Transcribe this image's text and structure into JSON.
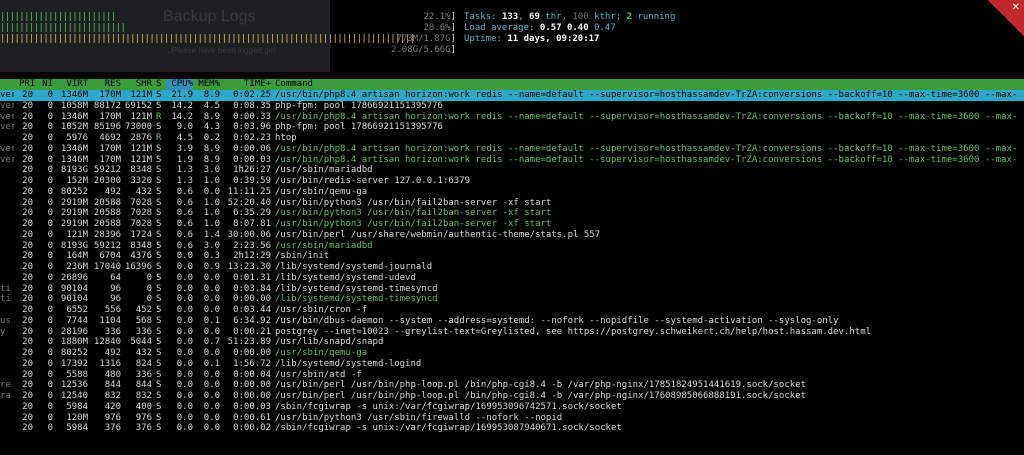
{
  "background": {
    "title": "Backup Logs",
    "subtitle": "...Please have been logged get"
  },
  "meters": [
    {
      "bars": "||||||||||||||||||||||||",
      "value": "22.1%"
    },
    {
      "bars": "||||||||||||||||||||||||||",
      "value": "28.6%"
    },
    {
      "bars": "||||||||||||||||||||||||||||||||||||||||||||||||||||||||||||||||||||||||||||||||||||||",
      "value": "773M/1.87G"
    },
    {
      "bars": "",
      "value": "2.08G/5.66G"
    }
  ],
  "stats": {
    "tasks_label": "Tasks: ",
    "tasks": "133",
    "thr": "69",
    "thr_label": " thr, ",
    "kthr": "100",
    "kthr_label": " kthr; ",
    "running": "2",
    "running_label": " running",
    "load_label": "Load average: ",
    "load1": "0.57",
    "load5": "0.40",
    "load15": "0.47",
    "uptime_label": "Uptime: ",
    "uptime": "11 days, 09:20:17"
  },
  "header": {
    "pri": "PRI",
    "ni": "NI",
    "virt": "VIRT",
    "res": "RES",
    "shr": "SHR",
    "s": "S",
    "cpu": "CPU%",
    "mem": "MEM%",
    "time": "TIME+",
    "command": "Command"
  },
  "processes": [
    {
      "user": "ver",
      "pri": "20",
      "ni": "0",
      "virt": "1346M",
      "res": "170M",
      "shr": "121M",
      "s": "S",
      "cpu": "21.9",
      "mem": "8.9",
      "time": "0:02.25",
      "command": "/usr/bin/php8.4 artisan horizon:work redis --name=default --supervisor=hosthassamdev-TrZA:conversions --backoff=10 --max-time=3600 --max-",
      "thread": false
    },
    {
      "user": "ver",
      "pri": "20",
      "ni": "0",
      "virt": "1058M",
      "res": "88172",
      "shr": "69152",
      "s": "S",
      "cpu": "14.2",
      "mem": "4.5",
      "time": "0:08.35",
      "command": "php-fpm: pool 17866921151395776",
      "thread": false
    },
    {
      "user": "ver",
      "pri": "20",
      "ni": "0",
      "virt": "1346M",
      "res": "170M",
      "shr": "121M",
      "s": "R",
      "cpu": "14.2",
      "mem": "8.9",
      "time": "0:00.33",
      "command": "/usr/bin/php8.4 artisan horizon:work redis --name=default --supervisor=hosthassamdev-TrZA:conversions --backoff=10 --max-time=3600 --max-",
      "thread": true
    },
    {
      "user": "ver",
      "pri": "20",
      "ni": "0",
      "virt": "1052M",
      "res": "85196",
      "shr": "73000",
      "s": "S",
      "cpu": "9.0",
      "mem": "4.3",
      "time": "0:03.96",
      "command": "php-fpm: pool 17866921151395776",
      "thread": false
    },
    {
      "user": "",
      "pri": "20",
      "ni": "0",
      "virt": "5976",
      "res": "4692",
      "shr": "2876",
      "s": "R",
      "cpu": "4.5",
      "mem": "0.2",
      "time": "0:02.23",
      "command": "htop",
      "thread": false
    },
    {
      "user": "ver",
      "pri": "20",
      "ni": "0",
      "virt": "1346M",
      "res": "170M",
      "shr": "121M",
      "s": "S",
      "cpu": "3.9",
      "mem": "8.9",
      "time": "0:00.06",
      "command": "/usr/bin/php8.4 artisan horizon:work redis --name=default --supervisor=hosthassamdev-TrZA:conversions --backoff=10 --max-time=3600 --max-",
      "thread": true
    },
    {
      "user": "ver",
      "pri": "20",
      "ni": "0",
      "virt": "1346M",
      "res": "170M",
      "shr": "121M",
      "s": "S",
      "cpu": "1.9",
      "mem": "8.9",
      "time": "0:00.03",
      "command": "/usr/bin/php8.4 artisan horizon:work redis --name=default --supervisor=hosthassamdev-TrZA:conversions --backoff=10 --max-time=3600 --max-",
      "thread": true
    },
    {
      "user": "",
      "pri": "20",
      "ni": "0",
      "virt": "8193G",
      "res": "59212",
      "shr": "8348",
      "s": "S",
      "cpu": "1.3",
      "mem": "3.0",
      "time": "1h26:27",
      "command": "/usr/sbin/mariadbd",
      "thread": false
    },
    {
      "user": "",
      "pri": "20",
      "ni": "0",
      "virt": "152M",
      "res": "20300",
      "shr": "3320",
      "s": "S",
      "cpu": "1.3",
      "mem": "1.0",
      "time": "0:39.59",
      "command": "/usr/bin/redis-server 127.0.0.1:6379",
      "thread": false
    },
    {
      "user": "",
      "pri": "20",
      "ni": "0",
      "virt": "80252",
      "res": "492",
      "shr": "432",
      "s": "S",
      "cpu": "0.6",
      "mem": "0.0",
      "time": "11:11.25",
      "command": "/usr/sbin/qemu-ga",
      "thread": false
    },
    {
      "user": "",
      "pri": "20",
      "ni": "0",
      "virt": "2919M",
      "res": "20588",
      "shr": "7028",
      "s": "S",
      "cpu": "0.6",
      "mem": "1.0",
      "time": "52:20.40",
      "command": "/usr/bin/python3 /usr/bin/fail2ban-server -xf start",
      "thread": false
    },
    {
      "user": "",
      "pri": "20",
      "ni": "0",
      "virt": "2919M",
      "res": "20588",
      "shr": "7028",
      "s": "S",
      "cpu": "0.6",
      "mem": "1.0",
      "time": "6:35.29",
      "command": "/usr/bin/python3 /usr/bin/fail2ban-server -xf start",
      "thread": true
    },
    {
      "user": "",
      "pri": "20",
      "ni": "0",
      "virt": "2919M",
      "res": "20588",
      "shr": "7028",
      "s": "S",
      "cpu": "0.6",
      "mem": "1.0",
      "time": "8:07.81",
      "command": "/usr/bin/python3 /usr/bin/fail2ban-server -xf start",
      "thread": true
    },
    {
      "user": "",
      "pri": "20",
      "ni": "0",
      "virt": "121M",
      "res": "28396",
      "shr": "1724",
      "s": "S",
      "cpu": "0.6",
      "mem": "1.4",
      "time": "30:00.06",
      "command": "/usr/bin/perl /usr/share/webmin/authentic-theme/stats.pl 557",
      "thread": false
    },
    {
      "user": "",
      "pri": "20",
      "ni": "0",
      "virt": "8193G",
      "res": "59212",
      "shr": "8348",
      "s": "S",
      "cpu": "0.6",
      "mem": "3.0",
      "time": "2:23.56",
      "command": "/usr/sbin/mariadbd",
      "thread": true
    },
    {
      "user": "",
      "pri": "20",
      "ni": "0",
      "virt": "164M",
      "res": "6704",
      "shr": "4376",
      "s": "S",
      "cpu": "0.0",
      "mem": "0.3",
      "time": "2h12:29",
      "command": "/sbin/init",
      "thread": false
    },
    {
      "user": "",
      "pri": "20",
      "ni": "0",
      "virt": "236M",
      "res": "17040",
      "shr": "16396",
      "s": "S",
      "cpu": "0.0",
      "mem": "0.9",
      "time": "13:23.30",
      "command": "/lib/systemd/systemd-journald",
      "thread": false
    },
    {
      "user": "",
      "pri": "20",
      "ni": "0",
      "virt": "26896",
      "res": "64",
      "shr": "0",
      "s": "S",
      "cpu": "0.0",
      "mem": "0.0",
      "time": "0:01.31",
      "command": "/lib/systemd/systemd-udevd",
      "thread": false
    },
    {
      "user": "ti",
      "pri": "20",
      "ni": "0",
      "virt": "90104",
      "res": "96",
      "shr": "0",
      "s": "S",
      "cpu": "0.0",
      "mem": "0.0",
      "time": "0:03.84",
      "command": "/lib/systemd/systemd-timesyncd",
      "thread": false
    },
    {
      "user": "ti",
      "pri": "20",
      "ni": "0",
      "virt": "90104",
      "res": "96",
      "shr": "0",
      "s": "S",
      "cpu": "0.0",
      "mem": "0.0",
      "time": "0:00.00",
      "command": "/lib/systemd/systemd-timesyncd",
      "thread": true
    },
    {
      "user": "",
      "pri": "20",
      "ni": "0",
      "virt": "6552",
      "res": "556",
      "shr": "452",
      "s": "S",
      "cpu": "0.0",
      "mem": "0.0",
      "time": "0:03.44",
      "command": "/usr/sbin/cron -f",
      "thread": false
    },
    {
      "user": "us",
      "pri": "20",
      "ni": "0",
      "virt": "7744",
      "res": "1104",
      "shr": "568",
      "s": "S",
      "cpu": "0.0",
      "mem": "0.1",
      "time": "6:34.92",
      "command": "/usr/bin/dbus-daemon --system --address=systemd: --nofork --nopidfile --systemd-activation --syslog-only",
      "thread": false
    },
    {
      "user": "y",
      "pri": "20",
      "ni": "0",
      "virt": "28196",
      "res": "336",
      "shr": "336",
      "s": "S",
      "cpu": "0.0",
      "mem": "0.0",
      "time": "0:00.21",
      "command": "postgrey --inet=10023 --greylist-text=Greylisted, see https://postgrey.schweikert.ch/help/host.hassam.dev.html",
      "thread": false
    },
    {
      "user": "",
      "pri": "20",
      "ni": "0",
      "virt": "1880M",
      "res": "12840",
      "shr": "5044",
      "s": "S",
      "cpu": "0.0",
      "mem": "0.7",
      "time": "51:23.89",
      "command": "/usr/lib/snapd/snapd",
      "thread": false
    },
    {
      "user": "",
      "pri": "20",
      "ni": "0",
      "virt": "80252",
      "res": "492",
      "shr": "432",
      "s": "S",
      "cpu": "0.0",
      "mem": "0.0",
      "time": "0:00.00",
      "command": "/usr/sbin/qemu-ga",
      "thread": true
    },
    {
      "user": "",
      "pri": "20",
      "ni": "0",
      "virt": "17392",
      "res": "1316",
      "shr": "824",
      "s": "S",
      "cpu": "0.0",
      "mem": "0.1",
      "time": "1:56.72",
      "command": "/lib/systemd/systemd-logind",
      "thread": false
    },
    {
      "user": "",
      "pri": "20",
      "ni": "0",
      "virt": "5588",
      "res": "480",
      "shr": "336",
      "s": "S",
      "cpu": "0.0",
      "mem": "0.0",
      "time": "0:00.04",
      "command": "/usr/sbin/atd -f",
      "thread": false
    },
    {
      "user": "re",
      "pri": "20",
      "ni": "0",
      "virt": "12536",
      "res": "844",
      "shr": "844",
      "s": "S",
      "cpu": "0.0",
      "mem": "0.0",
      "time": "0:00.00",
      "command": "/usr/bin/perl /usr/bin/php-loop.pl /bin/php-cgi8.4 -b /var/php-nginx/17851824951441619.sock/socket",
      "thread": false
    },
    {
      "user": "ra",
      "pri": "20",
      "ni": "0",
      "virt": "12540",
      "res": "832",
      "shr": "832",
      "s": "S",
      "cpu": "0.0",
      "mem": "0.0",
      "time": "0:00.00",
      "command": "/usr/bin/perl /usr/bin/php-loop.pl /bin/php-cgi8.4 -b /var/php-nginx/17608985066888191.sock/socket",
      "thread": false
    },
    {
      "user": "",
      "pri": "20",
      "ni": "0",
      "virt": "5984",
      "res": "420",
      "shr": "400",
      "s": "S",
      "cpu": "0.0",
      "mem": "0.0",
      "time": "0:00.03",
      "command": "/sbin/fcgiwrap -s unix:/var/fcgiwrap/169953096742571.sock/socket",
      "thread": false
    },
    {
      "user": "",
      "pri": "20",
      "ni": "0",
      "virt": "120M",
      "res": "976",
      "shr": "976",
      "s": "S",
      "cpu": "0.0",
      "mem": "0.0",
      "time": "0:00.61",
      "command": "/usr/bin/python3 /usr/sbin/firewalld --nofork --nopid",
      "thread": false
    },
    {
      "user": "",
      "pri": "20",
      "ni": "0",
      "virt": "5984",
      "res": "376",
      "shr": "376",
      "s": "S",
      "cpu": "0.0",
      "mem": "0.0",
      "time": "0:00.02",
      "command": "/sbin/fcgiwrap -s unix:/var/fcgiwrap/169953087940671.sock/socket",
      "thread": false
    }
  ],
  "selected_index": 0,
  "colors": {
    "header_bg": "#3a9c3a",
    "selected_bg": "#2ea8c8",
    "thread_text": "#5ec05e",
    "stats_text": "#4fb6c8"
  }
}
